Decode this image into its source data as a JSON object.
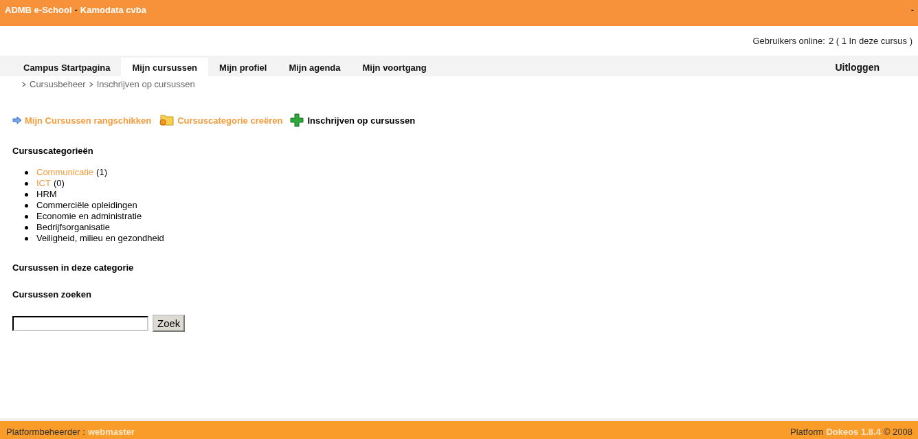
{
  "header": {
    "site": "ADMB e-School",
    "separator": "-",
    "institution": "Kamodata cvba",
    "right_mark": "-"
  },
  "online": {
    "label": "Gebruikers online:",
    "text": "2 ( 1 In deze cursus )"
  },
  "tabs": [
    {
      "label": "Campus Startpagina",
      "selected": false
    },
    {
      "label": "Mijn cursussen",
      "selected": true
    },
    {
      "label": "Mijn profiel",
      "selected": false
    },
    {
      "label": "Mijn agenda",
      "selected": false
    },
    {
      "label": "Mijn voortgang",
      "selected": false
    }
  ],
  "logout": "Uitloggen",
  "breadcrumb": [
    "Cursusbeheer",
    "Inschrijven op cursussen"
  ],
  "actions": [
    {
      "label": "Mijn Cursussen rangschikken",
      "kind": "arrow",
      "current": false
    },
    {
      "label": "Cursuscategorie creëren",
      "kind": "folder",
      "current": false
    },
    {
      "label": "Inschrijven op cursussen",
      "kind": "plus",
      "current": true
    }
  ],
  "categories_heading": "Cursuscategorieën",
  "categories": [
    {
      "name": "Communicatie",
      "kind": "link",
      "count": "(1)"
    },
    {
      "name": "ICT",
      "kind": "link",
      "count": "(0)"
    },
    {
      "name": "HRM",
      "kind": "plain"
    },
    {
      "name": "Commerciële opleidingen",
      "kind": "plain"
    },
    {
      "name": "Economie en administratie",
      "kind": "plain"
    },
    {
      "name": "Bedrijfsorganisatie",
      "kind": "plain"
    },
    {
      "name": "Veiligheid, milieu en gezondheid",
      "kind": "plain"
    }
  ],
  "courses_heading": "Cursussen in deze categorie",
  "search_heading": "Cursussen zoeken",
  "search": {
    "button": "Zoek"
  },
  "footer": {
    "admin_label": "Platformbeheerder :",
    "admin_link": "webmaster",
    "platform_label": "Platform",
    "platform_link": "Dokeos 1.8.4",
    "copyright": "© 2008"
  }
}
